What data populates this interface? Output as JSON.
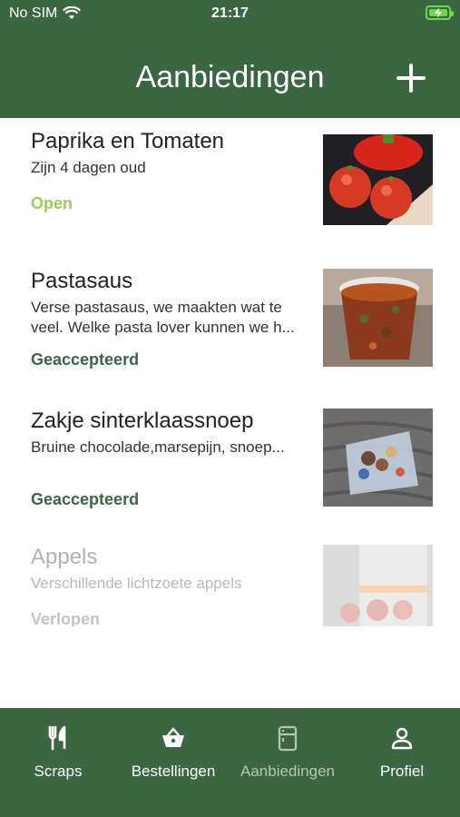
{
  "status_bar": {
    "carrier": "No SIM",
    "time": "21:17"
  },
  "header": {
    "title": "Aanbiedingen"
  },
  "offers": [
    {
      "name": "Paprika en Tomaten",
      "description": "Zijn 4 dagen oud",
      "status": "Open"
    },
    {
      "name": "Pastasaus",
      "description": "Verse pastasaus, we maakten wat te veel. Welke pasta lover kunnen we h...",
      "status": "Geaccepteerd"
    },
    {
      "name": "Zakje sinterklaassnoep",
      "description": "Bruine chocolade,marsepijn, snoep...",
      "status": "Geaccepteerd"
    },
    {
      "name": "Appels",
      "description": "Verschillende lichtzoete appels",
      "status": "Verlopen"
    }
  ],
  "tabs": [
    {
      "label": "Scraps",
      "icon": "fork-knife-icon"
    },
    {
      "label": "Bestellingen",
      "icon": "basket-icon"
    },
    {
      "label": "Aanbiedingen",
      "icon": "fridge-icon",
      "active": true
    },
    {
      "label": "Profiel",
      "icon": "person-icon"
    }
  ],
  "colors": {
    "primary": "#3b6642",
    "open": "#9ccc55",
    "accepted": "#3b6642",
    "inactive_tab": "#b7c6b2",
    "battery": "#6fd64e"
  }
}
